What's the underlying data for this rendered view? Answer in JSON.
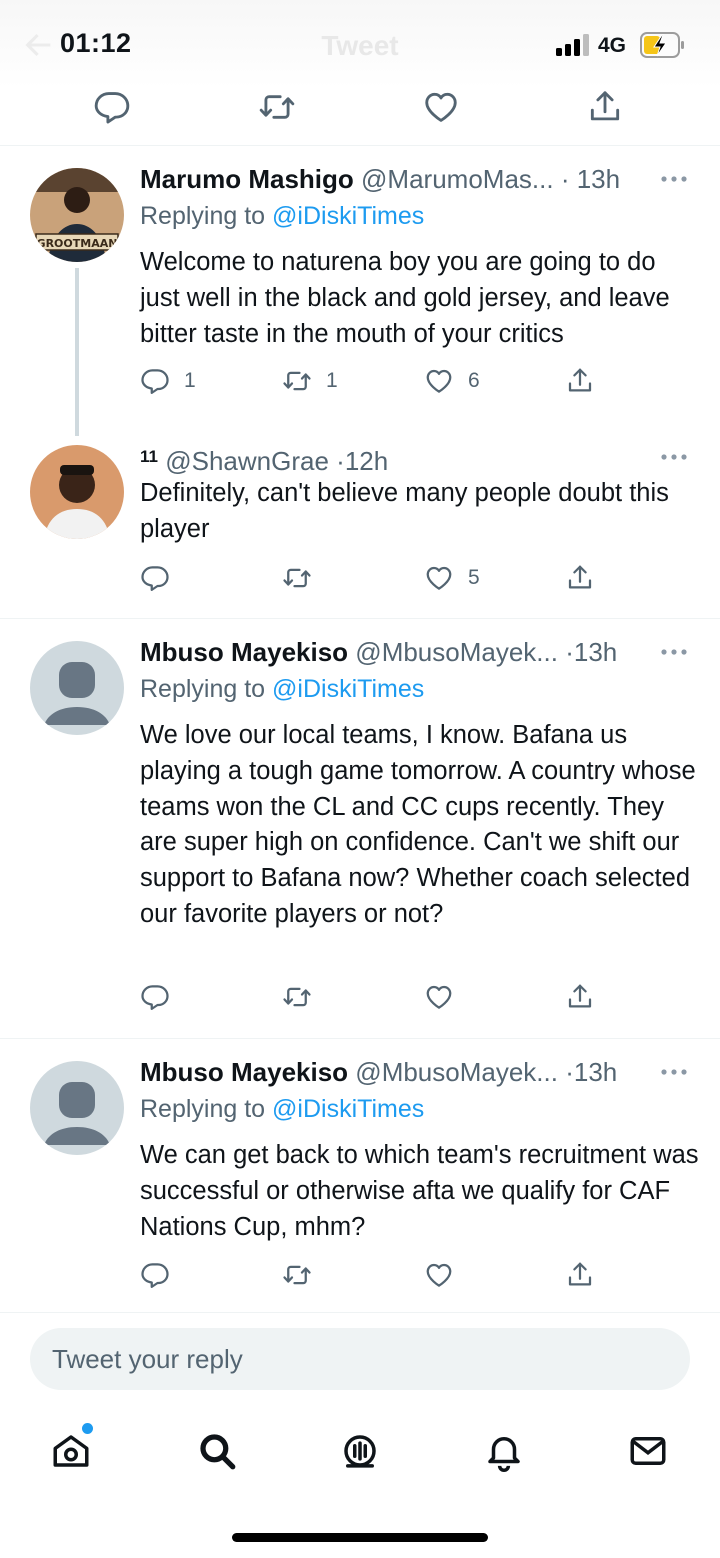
{
  "status_bar": {
    "time": "01:12",
    "network": "4G",
    "faded_title": "Tweet"
  },
  "tweets": [
    {
      "name": "Marumo Mashigo",
      "handle": "@MarumoMas...",
      "time": "13h",
      "replying_prefix": "Replying to",
      "replying_handle": "@iDiskiTimes",
      "text": "Welcome to naturena boy you are going to do just well in the black and gold jersey, and leave bitter taste in the mouth of your critics",
      "replies": "1",
      "retweets": "1",
      "likes": "6",
      "avatar_caption": "GROOTMAAN"
    },
    {
      "name": "11",
      "handle": "@ShawnGrae",
      "time": "12h",
      "text": "Definitely, can't believe many people doubt this player",
      "replies": "",
      "retweets": "",
      "likes": "5"
    },
    {
      "name": "Mbuso Mayekiso",
      "handle": "@MbusoMayek...",
      "time": "13h",
      "replying_prefix": "Replying to",
      "replying_handle": "@iDiskiTimes",
      "text": "We love our local teams, I know. Bafana us playing a tough game tomorrow. A country whose teams won the CL and CC cups recently. They are super high on confidence. Can't we shift our support to Bafana now? Whether coach selected our favorite players or not?",
      "replies": "",
      "retweets": "",
      "likes": ""
    },
    {
      "name": "Mbuso Mayekiso",
      "handle": "@MbusoMayek...",
      "time": "13h",
      "replying_prefix": "Replying to",
      "replying_handle": "@iDiskiTimes",
      "text": "We can get back to which team's recruitment was successful or otherwise afta we qualify for CAF Nations Cup, mhm?",
      "replies": "",
      "retweets": "",
      "likes": ""
    }
  ],
  "reply_box": {
    "placeholder": "Tweet your reply"
  },
  "tabs": [
    "home-icon",
    "search-icon",
    "spaces-icon",
    "notifications-icon",
    "messages-icon"
  ],
  "colors": {
    "accent": "#1d9bf0",
    "secondary_text": "#536471",
    "divider": "#eff3f4"
  }
}
